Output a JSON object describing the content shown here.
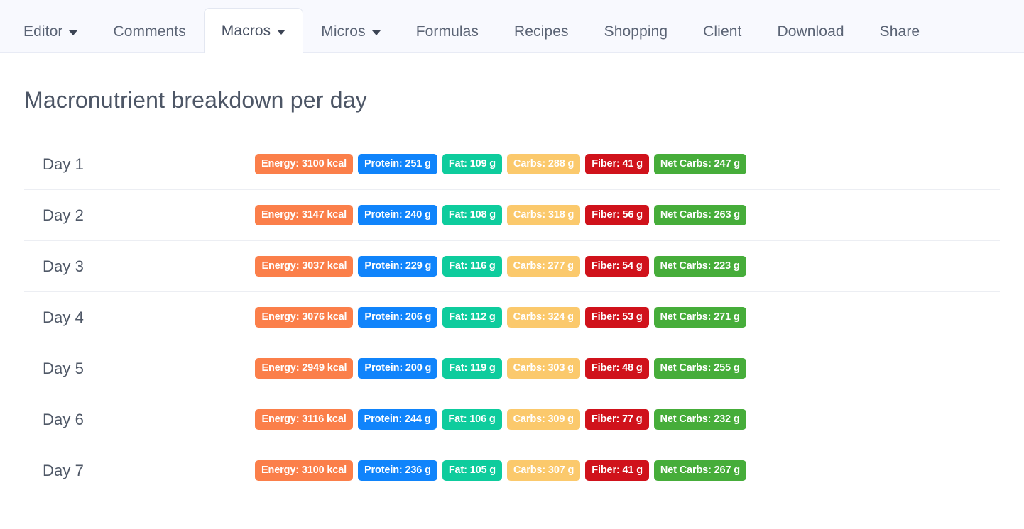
{
  "tabs": [
    {
      "label": "Editor",
      "caret": true,
      "active": false
    },
    {
      "label": "Comments",
      "caret": false,
      "active": false
    },
    {
      "label": "Macros",
      "caret": true,
      "active": true
    },
    {
      "label": "Micros",
      "caret": true,
      "active": false
    },
    {
      "label": "Formulas",
      "caret": false,
      "active": false
    },
    {
      "label": "Recipes",
      "caret": false,
      "active": false
    },
    {
      "label": "Shopping",
      "caret": false,
      "active": false
    },
    {
      "label": "Client",
      "caret": false,
      "active": false
    },
    {
      "label": "Download",
      "caret": false,
      "active": false
    },
    {
      "label": "Share",
      "caret": false,
      "active": false
    }
  ],
  "page": {
    "title": "Macronutrient breakdown per day"
  },
  "colors": {
    "energy": "#fb7f4a",
    "protein": "#1084fb",
    "fat": "#0ecc9d",
    "carbs": "#fbc96c",
    "fiber": "#d0121b",
    "net_carbs": "#46ad3a",
    "page_text": "#4f5867",
    "tabbar_bg": "#f8f9fe"
  },
  "chart_data": {
    "type": "table",
    "title": "Macronutrient breakdown per day",
    "categories": [
      "Day 1",
      "Day 2",
      "Day 3",
      "Day 4",
      "Day 5",
      "Day 6",
      "Day 7"
    ],
    "series": [
      {
        "name": "Energy",
        "unit": "kcal",
        "values": [
          3100,
          3147,
          3037,
          3076,
          2949,
          3116,
          3100
        ]
      },
      {
        "name": "Protein",
        "unit": "g",
        "values": [
          251,
          240,
          229,
          206,
          200,
          244,
          236
        ]
      },
      {
        "name": "Fat",
        "unit": "g",
        "values": [
          109,
          108,
          116,
          112,
          119,
          106,
          105
        ]
      },
      {
        "name": "Carbs",
        "unit": "g",
        "values": [
          288,
          318,
          277,
          324,
          303,
          309,
          307
        ]
      },
      {
        "name": "Fiber",
        "unit": "g",
        "values": [
          41,
          56,
          54,
          53,
          48,
          77,
          41
        ]
      },
      {
        "name": "Net Carbs",
        "unit": "g",
        "values": [
          247,
          263,
          223,
          271,
          255,
          232,
          267
        ]
      }
    ]
  },
  "rows": [
    {
      "day": "Day 1",
      "badges": [
        {
          "key": "energy",
          "text": "Energy: 3100 kcal"
        },
        {
          "key": "protein",
          "text": "Protein: 251 g"
        },
        {
          "key": "fat",
          "text": "Fat: 109 g"
        },
        {
          "key": "carbs",
          "text": "Carbs: 288 g"
        },
        {
          "key": "fiber",
          "text": "Fiber: 41 g"
        },
        {
          "key": "net_carbs",
          "text": "Net Carbs: 247 g"
        }
      ]
    },
    {
      "day": "Day 2",
      "badges": [
        {
          "key": "energy",
          "text": "Energy: 3147 kcal"
        },
        {
          "key": "protein",
          "text": "Protein: 240 g"
        },
        {
          "key": "fat",
          "text": "Fat: 108 g"
        },
        {
          "key": "carbs",
          "text": "Carbs: 318 g"
        },
        {
          "key": "fiber",
          "text": "Fiber: 56 g"
        },
        {
          "key": "net_carbs",
          "text": "Net Carbs: 263 g"
        }
      ]
    },
    {
      "day": "Day 3",
      "badges": [
        {
          "key": "energy",
          "text": "Energy: 3037 kcal"
        },
        {
          "key": "protein",
          "text": "Protein: 229 g"
        },
        {
          "key": "fat",
          "text": "Fat: 116 g"
        },
        {
          "key": "carbs",
          "text": "Carbs: 277 g"
        },
        {
          "key": "fiber",
          "text": "Fiber: 54 g"
        },
        {
          "key": "net_carbs",
          "text": "Net Carbs: 223 g"
        }
      ]
    },
    {
      "day": "Day 4",
      "badges": [
        {
          "key": "energy",
          "text": "Energy: 3076 kcal"
        },
        {
          "key": "protein",
          "text": "Protein: 206 g"
        },
        {
          "key": "fat",
          "text": "Fat: 112 g"
        },
        {
          "key": "carbs",
          "text": "Carbs: 324 g"
        },
        {
          "key": "fiber",
          "text": "Fiber: 53 g"
        },
        {
          "key": "net_carbs",
          "text": "Net Carbs: 271 g"
        }
      ]
    },
    {
      "day": "Day 5",
      "badges": [
        {
          "key": "energy",
          "text": "Energy: 2949 kcal"
        },
        {
          "key": "protein",
          "text": "Protein: 200 g"
        },
        {
          "key": "fat",
          "text": "Fat: 119 g"
        },
        {
          "key": "carbs",
          "text": "Carbs: 303 g"
        },
        {
          "key": "fiber",
          "text": "Fiber: 48 g"
        },
        {
          "key": "net_carbs",
          "text": "Net Carbs: 255 g"
        }
      ]
    },
    {
      "day": "Day 6",
      "badges": [
        {
          "key": "energy",
          "text": "Energy: 3116 kcal"
        },
        {
          "key": "protein",
          "text": "Protein: 244 g"
        },
        {
          "key": "fat",
          "text": "Fat: 106 g"
        },
        {
          "key": "carbs",
          "text": "Carbs: 309 g"
        },
        {
          "key": "fiber",
          "text": "Fiber: 77 g"
        },
        {
          "key": "net_carbs",
          "text": "Net Carbs: 232 g"
        }
      ]
    },
    {
      "day": "Day 7",
      "badges": [
        {
          "key": "energy",
          "text": "Energy: 3100 kcal"
        },
        {
          "key": "protein",
          "text": "Protein: 236 g"
        },
        {
          "key": "fat",
          "text": "Fat: 105 g"
        },
        {
          "key": "carbs",
          "text": "Carbs: 307 g"
        },
        {
          "key": "fiber",
          "text": "Fiber: 41 g"
        },
        {
          "key": "net_carbs",
          "text": "Net Carbs: 267 g"
        }
      ]
    }
  ]
}
